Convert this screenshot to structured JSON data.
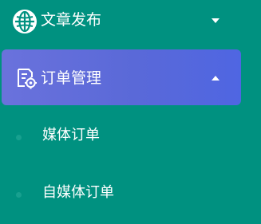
{
  "menu": {
    "article_publish": {
      "label": "文章发布",
      "icon": "globe-icon",
      "expanded": false
    },
    "order_management": {
      "label": "订单管理",
      "icon": "document-gear-icon",
      "expanded": true,
      "active": true,
      "children": [
        {
          "label": "媒体订单"
        },
        {
          "label": "自媒体订单"
        }
      ]
    }
  },
  "colors": {
    "sidebar_background": "#009180",
    "active_item_gradient_start": "#6a72dc",
    "active_item_gradient_end": "#4f66e2",
    "text": "#ffffff",
    "sub_item_dot": "#17a08f"
  }
}
